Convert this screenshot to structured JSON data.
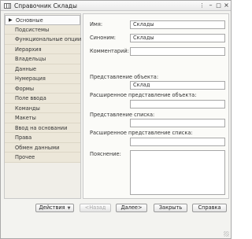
{
  "window": {
    "title": "Справочник Склады",
    "controls": {
      "menu": "⋮",
      "minimize": "–",
      "maximize": "□",
      "close": "×"
    }
  },
  "sidebar": {
    "items": [
      {
        "label": "Основные",
        "active": true
      },
      {
        "label": "Подсистемы"
      },
      {
        "label": "Функциональные опции"
      },
      {
        "label": "Иерархия"
      },
      {
        "label": "Владельцы"
      },
      {
        "label": "Данные"
      },
      {
        "label": "Нумерация"
      },
      {
        "label": "Формы"
      },
      {
        "label": "Поле ввода"
      },
      {
        "label": "Команды"
      },
      {
        "label": "Макеты"
      },
      {
        "label": "Ввод на основании"
      },
      {
        "label": "Права"
      },
      {
        "label": "Обмен данными"
      },
      {
        "label": "Прочее"
      }
    ]
  },
  "form": {
    "name_label": "Имя:",
    "name_value": "Склады",
    "synonym_label": "Синоним:",
    "synonym_value": "Склады",
    "comment_label": "Комментарий:",
    "comment_value": "",
    "object_repr_label": "Представление объекта:",
    "object_repr_value": "Склад",
    "ext_object_repr_label": "Расширенное представление объекта:",
    "ext_object_repr_value": "",
    "list_repr_label": "Представление списка:",
    "list_repr_value": "",
    "ext_list_repr_label": "Расширенное представление списка:",
    "ext_list_repr_value": "",
    "explanation_label": "Пояснение:",
    "explanation_value": ""
  },
  "buttons": {
    "actions": "Действия",
    "back": "<Назад",
    "next": "Далее>",
    "close": "Закрыть",
    "help": "Справка"
  }
}
